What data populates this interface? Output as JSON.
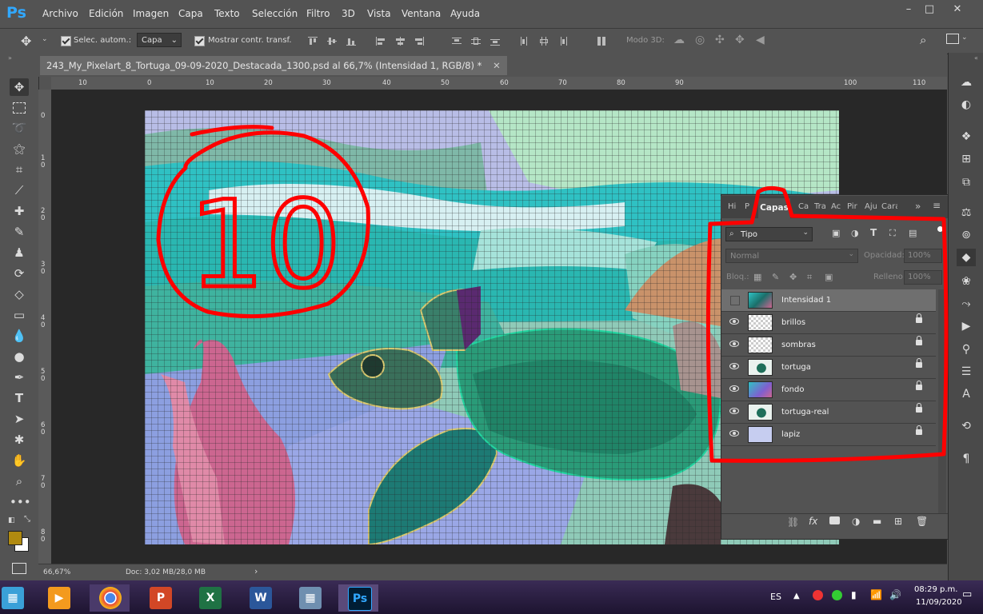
{
  "app": {
    "logo": "Ps",
    "menu": [
      "Archivo",
      "Edición",
      "Imagen",
      "Capa",
      "Texto",
      "Selección",
      "Filtro",
      "3D",
      "Vista",
      "Ventana",
      "Ayuda"
    ],
    "window_controls": [
      "–",
      "□",
      "✕"
    ]
  },
  "options_bar": {
    "auto_select_label": "Selec. autom.:",
    "auto_select_target": "Capa",
    "show_transform_label": "Mostrar contr. transf.",
    "mode_3d_label": "Modo 3D:"
  },
  "document": {
    "tab_title": "243_My_Pixelart_8_Tortuga_09-09-2020_Destacada_1300.psd al 66,7% (Intensidad 1, RGB/8) *",
    "ruler_top_ticks": [
      "10",
      "0",
      "10",
      "20",
      "30",
      "40",
      "50",
      "60",
      "70",
      "80",
      "90",
      "100",
      "110"
    ],
    "ruler_left_ticks": [
      "0",
      "1\n0",
      "2\n0",
      "3\n0",
      "4\n0",
      "5\n0",
      "6\n0",
      "7\n0",
      "8\n0"
    ]
  },
  "annotation": {
    "number": "10",
    "color": "#ff0000"
  },
  "layers_panel": {
    "tabs": [
      "Hi",
      "P",
      "Capas",
      "Ca",
      "Tra",
      "Ac",
      "Pir",
      "Aju",
      "Carac"
    ],
    "active_tab": "Capas",
    "filter_kind": "Tipo",
    "blend_mode": "Normal",
    "opacity_label": "Opacidad:",
    "opacity_value": "100%",
    "lock_label": "Bloq.:",
    "fill_label": "Relleno:",
    "fill_value": "100%",
    "layers": [
      {
        "name": "Intensidad 1",
        "visible": false,
        "locked": false,
        "selected": true,
        "thumb": "adjust"
      },
      {
        "name": "brillos",
        "visible": true,
        "locked": true,
        "selected": false,
        "thumb": "checker"
      },
      {
        "name": "sombras",
        "visible": true,
        "locked": true,
        "selected": false,
        "thumb": "checker"
      },
      {
        "name": "tortuga",
        "visible": true,
        "locked": true,
        "selected": false,
        "thumb": "turtle"
      },
      {
        "name": "fondo",
        "visible": true,
        "locked": true,
        "selected": false,
        "thumb": "bg"
      },
      {
        "name": "tortuga-real",
        "visible": true,
        "locked": true,
        "selected": false,
        "thumb": "turtle"
      },
      {
        "name": "lapiz",
        "visible": true,
        "locked": true,
        "selected": false,
        "thumb": "sketch"
      }
    ]
  },
  "status_bar": {
    "zoom": "66,67%",
    "doc_info": "Doc: 3,02 MB/28,0 MB"
  },
  "taskbar": {
    "language": "ES",
    "time": "08:29 p.m.",
    "date": "11/09/2020"
  },
  "colors": {
    "foreground": "#b08a10",
    "background": "#ffffff",
    "ps_blue": "#31a8ff",
    "annotation_red": "#ff0000"
  }
}
